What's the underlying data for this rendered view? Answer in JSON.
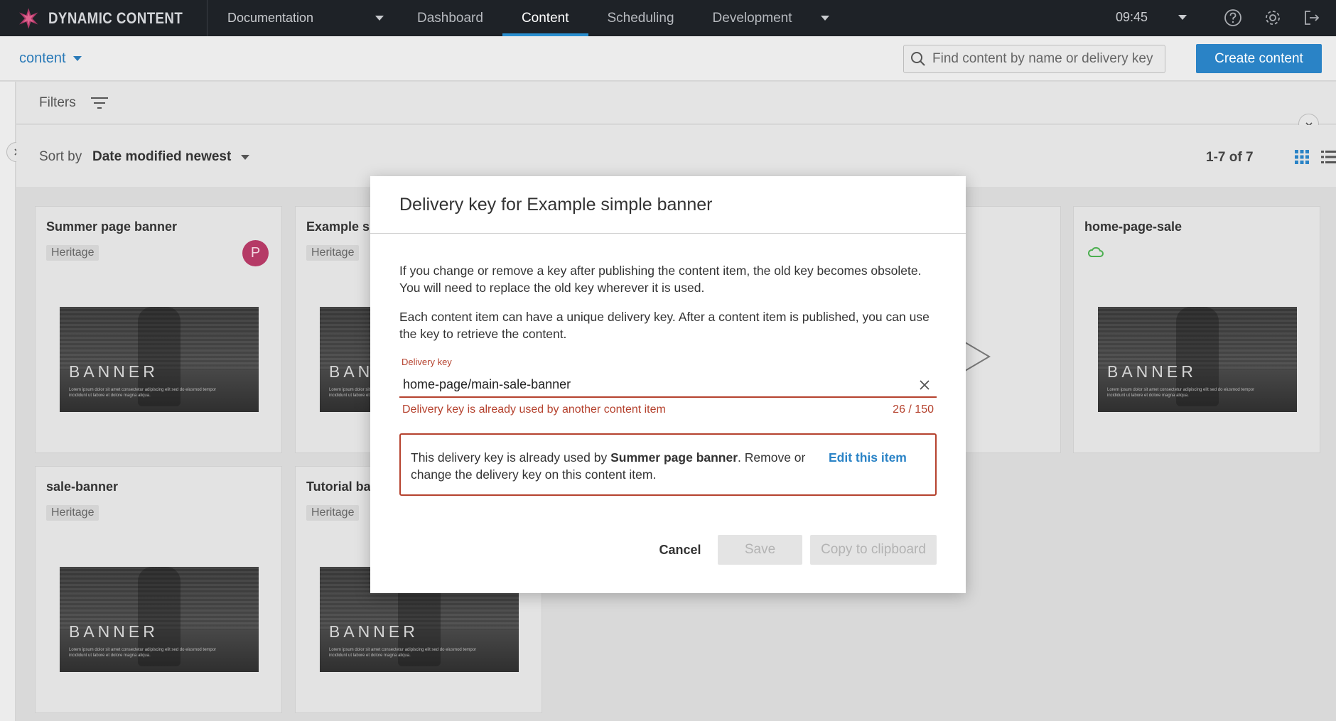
{
  "app": {
    "brand": "DYNAMIC CONTENT",
    "hub": "Documentation",
    "nav": [
      "Dashboard",
      "Content",
      "Scheduling",
      "Development"
    ],
    "active_nav": "Content",
    "time": "09:45"
  },
  "subbar": {
    "repository": "content",
    "search_placeholder": "Find content by name or delivery key",
    "create_label": "Create content"
  },
  "toolbar": {
    "filters_label": "Filters",
    "sort_label": "Sort by",
    "sort_value": "Date modified newest",
    "count": "1-7 of 7"
  },
  "cards": [
    {
      "title": "Summer page banner",
      "chip": "Heritage",
      "avatar": "P",
      "thumb_word": "BANNER",
      "thumb_small": "Lorem ipsum dolor sit amet consectetur adipiscing elit sed do eiusmod tempor incididunt ut labore et dolore magna aliqua."
    },
    {
      "title": "Example simple banner",
      "chip": "Heritage",
      "thumb_word": "BANNER",
      "thumb_small": "Lorem ipsum dolor sit amet consectetur adipiscing elit sed do eiusmod tempor incididunt ut labore et dolore magna aliqua."
    },
    {
      "title": "home-page-sale",
      "thumb_word": "BANNER",
      "thumb_small": "Lorem ipsum dolor sit amet consectetur adipiscing elit sed do eiusmod tempor incididunt ut labore et dolore magna aliqua."
    },
    {
      "title": "sale-banner",
      "chip": "Heritage",
      "thumb_word": "BANNER",
      "thumb_small": "Lorem ipsum dolor sit amet consectetur adipiscing elit sed do eiusmod tempor incididunt ut labore et dolore magna aliqua."
    },
    {
      "title": "Tutorial banner",
      "chip": "Heritage",
      "thumb_word": "BANNER",
      "thumb_small": "Lorem ipsum dolor sit amet consectetur adipiscing elit sed do eiusmod tempor incididunt ut labore et dolore magna aliqua."
    }
  ],
  "modal": {
    "title": "Delivery key for Example simple banner",
    "para1": "If you change or remove a key after publishing the content item, the old key becomes obsolete. You will need to replace the old key wherever it is used.",
    "para2": "Each content item can have a unique delivery key. After a content item is published, you can use the key to retrieve the content.",
    "field_label": "Delivery key",
    "field_value": "home-page/main-sale-banner",
    "field_error": "Delivery key is already used by another content item",
    "field_counter": "26 / 150",
    "error_prefix": "This delivery key is already used by ",
    "error_item": "Summer page banner",
    "error_suffix": ". Remove or change the delivery key on this content item.",
    "edit_link": "Edit this item",
    "cancel": "Cancel",
    "save": "Save",
    "copy": "Copy to clipboard"
  },
  "colors": {
    "accent": "#2a83c6",
    "error": "#b5422e",
    "topbar": "#1e2227",
    "avatar": "#b53a66"
  }
}
